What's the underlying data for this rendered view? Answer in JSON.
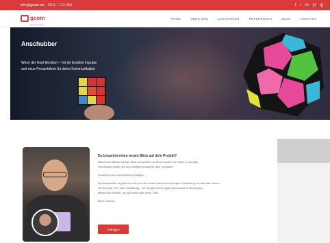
{
  "topbar": {
    "contact": "info@gcom.de · 0911 / 123 456",
    "socials": [
      "f",
      "t",
      "in",
      "yt",
      "ig"
    ]
  },
  "header": {
    "logo_text": "gcom",
    "logo_sub": "kommunikation",
    "nav": [
      "Home",
      "Über uns",
      "Leistungen",
      "Referenzen",
      "Blog",
      "Kontakt"
    ]
  },
  "hero": {
    "title": "Anschubber",
    "subtitle_line1": "Wenn der Kopf blockiert – hol dir kreative Impulse",
    "subtitle_line2": "und neue Perspektiven für deine Kommunikation"
  },
  "content": {
    "question": "Du brauchst einen neuen Blick auf dein Projekt?",
    "lines": [
      "Manchmal hilft ein frischer Blick von außen, um Ideen wieder ins Rollen zu bringen.",
      "Gemeinsam finden wir den richtigen Ansatz für dein Vorhaben."
    ],
    "highlight": "Kostenlos und unverbindlich anfragen",
    "paragraph": [
      "Als Anschubber begleite ich dich von der ersten Idee bis zur fertigen Umsetzung und darüber hinaus.",
      "Ob Konzept, Text oder Gestaltung – wir bringen dein Projekt gemeinsam in Bewegung.",
      "Melde dich einfach, wir sprechen über deine Ziele."
    ],
    "small_link": "Mehr erfahren",
    "cta_label": "Anfragen"
  },
  "colors": {
    "accent": "#d93a3a",
    "hero_dark": "#131a2a"
  }
}
